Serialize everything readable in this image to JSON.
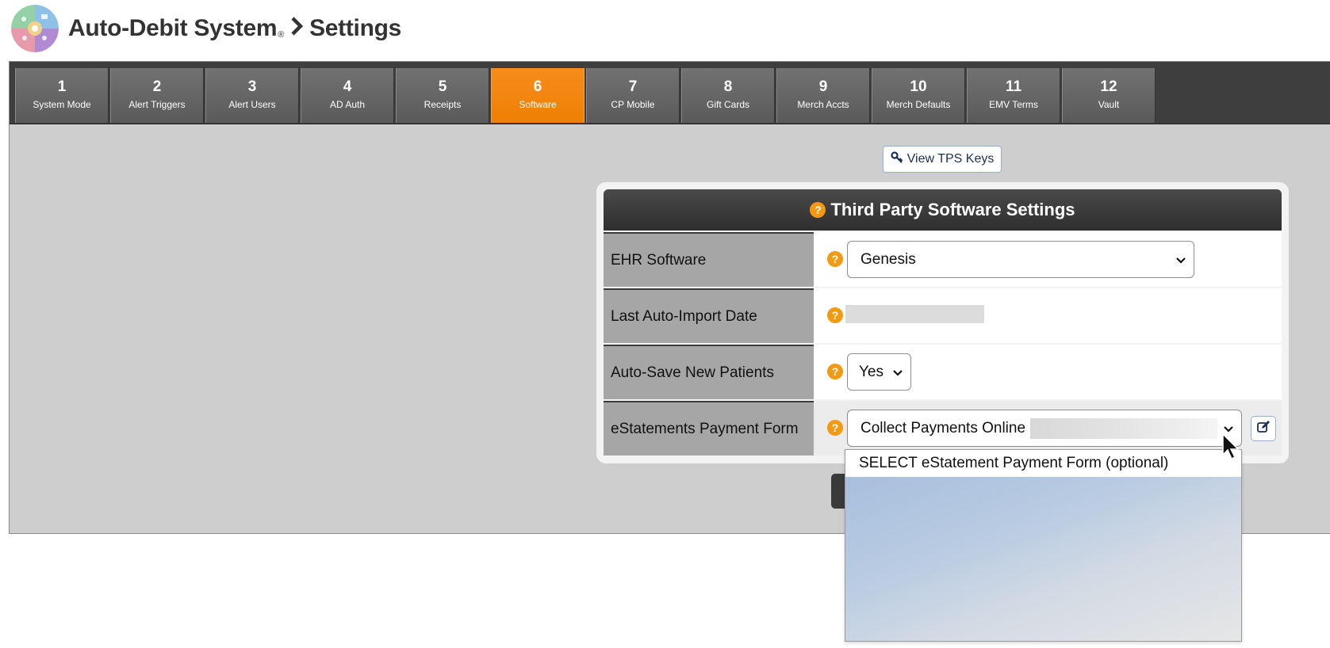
{
  "header": {
    "app_title": "Auto-Debit System",
    "registered_mark": "®",
    "page_title": "Settings"
  },
  "tabs": [
    {
      "num": "1",
      "label": "System Mode"
    },
    {
      "num": "2",
      "label": "Alert Triggers"
    },
    {
      "num": "3",
      "label": "Alert Users"
    },
    {
      "num": "4",
      "label": "AD Auth"
    },
    {
      "num": "5",
      "label": "Receipts"
    },
    {
      "num": "6",
      "label": "Software",
      "active": true
    },
    {
      "num": "7",
      "label": "CP Mobile"
    },
    {
      "num": "8",
      "label": "Gift Cards"
    },
    {
      "num": "9",
      "label": "Merch Accts"
    },
    {
      "num": "10",
      "label": "Merch Defaults"
    },
    {
      "num": "11",
      "label": "EMV Terms"
    },
    {
      "num": "12",
      "label": "Vault"
    }
  ],
  "tps_button": {
    "label": "View TPS Keys",
    "icon": "key-icon"
  },
  "settings": {
    "title": "Third Party Software Settings",
    "help_icon": "question-icon",
    "rows": {
      "ehr": {
        "label": "EHR Software",
        "value": "Genesis"
      },
      "last_import": {
        "label": "Last Auto-Import Date",
        "value": ""
      },
      "auto_save": {
        "label": "Auto-Save New Patients",
        "value": "Yes"
      },
      "estatements": {
        "label": "eStatements Payment Form",
        "value": "Collect Payments Online"
      }
    },
    "edit_icon": "edit-icon"
  },
  "dropdown": {
    "options": [
      "SELECT eStatement Payment Form (optional)"
    ]
  },
  "colors": {
    "active_tab": "#f68d1a",
    "help_icon": "#f29a12",
    "tab_bar": "#3e3e3e",
    "panel_bg": "#cecece"
  }
}
